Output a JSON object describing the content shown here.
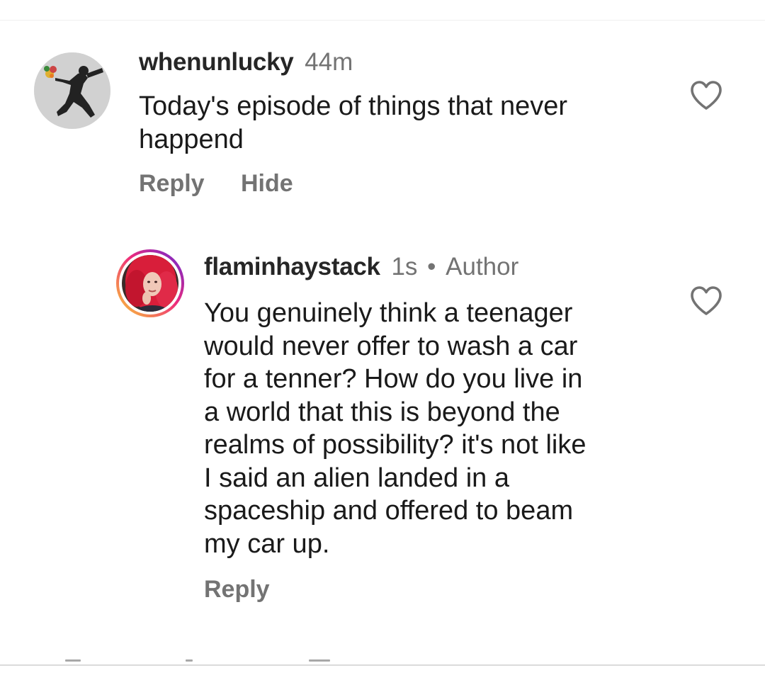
{
  "comments": [
    {
      "username": "whenunlucky",
      "time": "44m",
      "text": "Today's episode of things that never\nhappend",
      "actions": {
        "reply": "Reply",
        "hide": "Hide"
      },
      "liked": false
    },
    {
      "username": "flaminhaystack",
      "time": "1s",
      "separator": "•",
      "badge": "Author",
      "text": "You genuinely think a teenager\nwould never offer to wash a car\nfor a tenner? How do you live in\na world that this is beyond the\nrealms of possibility? it's not like\nI said an alien landed in a\nspaceship and offered to beam\nmy car up.",
      "actions": {
        "reply": "Reply"
      },
      "liked": false
    }
  ],
  "icons": {
    "avatar_1": "banksy-flower-thrower-avatar",
    "avatar_2": "red-hair-portrait-avatar",
    "like": "heart-outline-icon"
  },
  "colors": {
    "username": "#262626",
    "meta": "#737373",
    "text": "#1a1a1a",
    "story_ring_start": "#f9ce34",
    "story_ring_mid": "#ee2a7b",
    "story_ring_end": "#6228d7"
  }
}
